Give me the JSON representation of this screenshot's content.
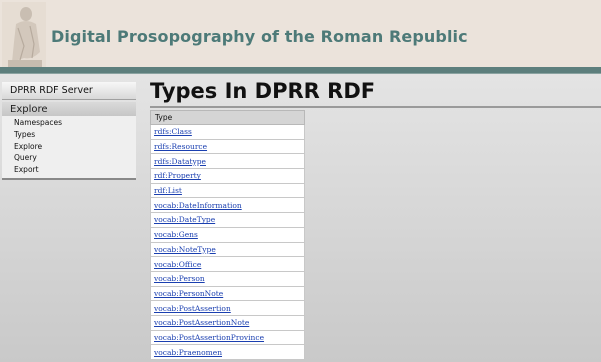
{
  "header": {
    "title": "Digital Prosopography of the Roman Republic"
  },
  "sidebar": {
    "heading": "DPRR RDF Server",
    "section": "Explore",
    "items": [
      {
        "label": "Namespaces"
      },
      {
        "label": "Types"
      },
      {
        "label": "Explore"
      },
      {
        "label": "Query"
      },
      {
        "label": "Export"
      }
    ]
  },
  "main": {
    "title": "Types In DPRR RDF",
    "table": {
      "header": "Type",
      "rows": [
        "rdfs:Class",
        "rdfs:Resource",
        "rdfs:Datatype",
        "rdf:Property",
        "rdf:List",
        "vocab:DateInformation",
        "vocab:DateType",
        "vocab:Gens",
        "vocab:NoteType",
        "vocab:Office",
        "vocab:Person",
        "vocab:PersonNote",
        "vocab:PostAssertion",
        "vocab:PostAssertionNote",
        "vocab:PostAssertionProvince",
        "vocab:Praenomen"
      ]
    }
  },
  "colors": {
    "header_bg": "#ebe3db",
    "header_band": "#5d7f7d",
    "title_text": "#4d7a78",
    "link": "#1a3fb0"
  }
}
